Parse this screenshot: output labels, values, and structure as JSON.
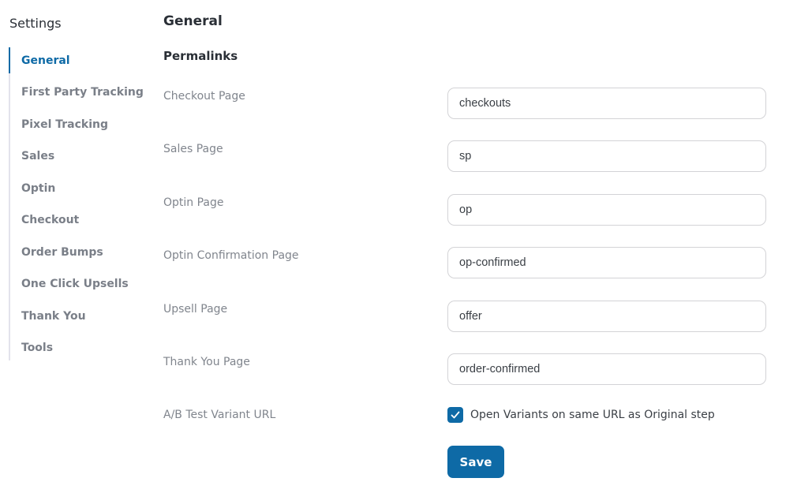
{
  "sidebar": {
    "title": "Settings",
    "items": [
      {
        "label": "General",
        "active": true
      },
      {
        "label": "First Party Tracking",
        "active": false
      },
      {
        "label": "Pixel Tracking",
        "active": false
      },
      {
        "label": "Sales",
        "active": false
      },
      {
        "label": "Optin",
        "active": false
      },
      {
        "label": "Checkout",
        "active": false
      },
      {
        "label": "Order Bumps",
        "active": false
      },
      {
        "label": "One Click Upsells",
        "active": false
      },
      {
        "label": "Thank You",
        "active": false
      },
      {
        "label": "Tools",
        "active": false
      }
    ]
  },
  "main": {
    "title": "General",
    "section": "Permalinks",
    "fields": [
      {
        "label": "Checkout Page",
        "value": "checkouts"
      },
      {
        "label": "Sales Page",
        "value": "sp"
      },
      {
        "label": "Optin Page",
        "value": "op"
      },
      {
        "label": "Optin Confirmation Page",
        "value": "op-confirmed"
      },
      {
        "label": "Upsell Page",
        "value": "offer"
      },
      {
        "label": "Thank You Page",
        "value": "order-confirmed"
      }
    ],
    "ab_test": {
      "label": "A/B Test Variant URL",
      "checkbox_label": "Open Variants on same URL as Original step",
      "checked": true
    },
    "save_label": "Save"
  },
  "colors": {
    "accent": "#0e6aa6",
    "muted_text": "#80858d",
    "border": "#d3d3d6"
  }
}
